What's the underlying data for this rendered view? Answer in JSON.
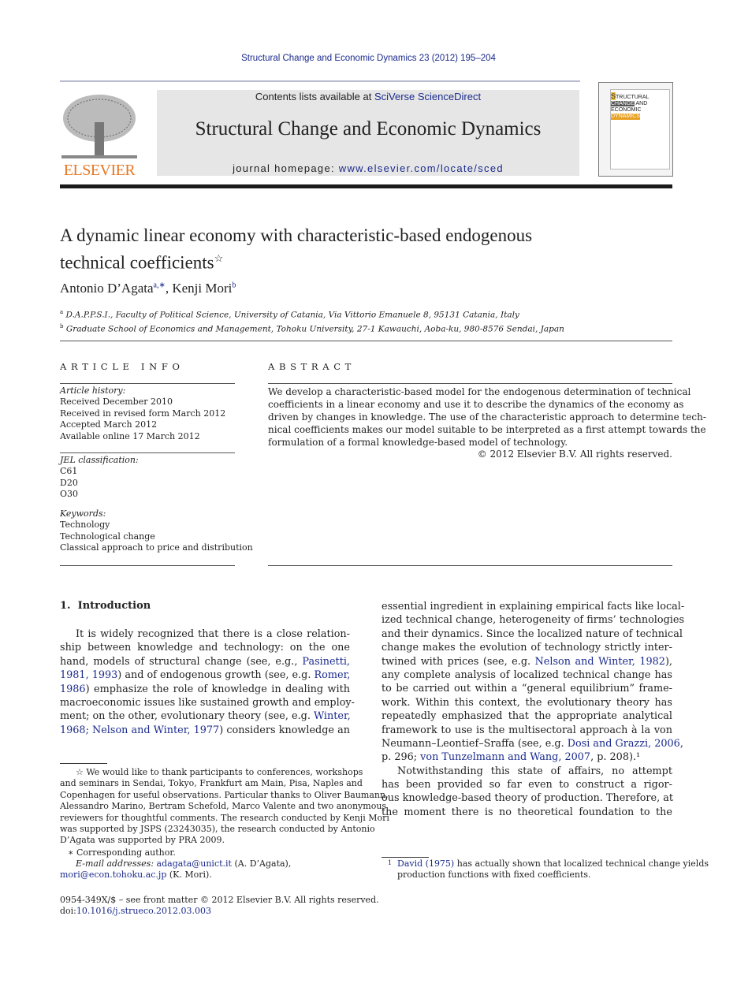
{
  "header": {
    "citation": "Structural Change and Economic Dynamics 23 (2012) 195–204",
    "contents_prefix": "Contents lists available at ",
    "contents_link": "SciVerse ScienceDirect",
    "journal_title": "Structural Change and Economic Dynamics",
    "homepage_prefix": "journal homepage: ",
    "homepage_link": "www.elsevier.com/locate/sced",
    "publisher_logo": "ELSEVIER",
    "cover_text": [
      "S",
      "TRUCTURAL",
      "CHANGE",
      "AND",
      "ECONOMIC",
      "DYNAMICS"
    ]
  },
  "article": {
    "title_line1": "A dynamic linear economy with characteristic-based endogenous",
    "title_line2": "technical coefficients",
    "title_mark": "☆",
    "authors": [
      {
        "name": "Antonio D’Agata",
        "sup": "a,∗"
      },
      {
        "name": "Kenji Mori",
        "sup": "b"
      }
    ],
    "affiliations": [
      {
        "mark": "a",
        "text": "D.A.P.P.S.I., Faculty of Political Science, University of Catania, Via Vittorio Emanuele 8, 95131 Catania, Italy"
      },
      {
        "mark": "b",
        "text": "Graduate School of Economics and Management, Tohoku University, 27-1 Kawauchi, Aoba-ku, 980-8576 Sendai, Japan"
      }
    ]
  },
  "info": {
    "heading": "A R T I C L E   I N F O",
    "history_label": "Article history:",
    "history": [
      "Received December 2010",
      "Received in revised form March 2012",
      "Accepted March 2012",
      "Available online 17 March 2012"
    ],
    "jel_label": "JEL classification:",
    "jel": [
      "C61",
      "D20",
      "O30"
    ],
    "keywords_label": "Keywords:",
    "keywords": [
      "Technology",
      "Technological change",
      "Classical approach to price and distribution"
    ]
  },
  "abstract": {
    "heading": "A B S T R A C T",
    "lines": [
      "We develop a characteristic-based model for the endogenous determination of technical",
      "coefficients in a linear economy and use it to describe the dynamics of the economy as",
      "driven by changes in knowledge. The use of the characteristic approach to determine tech-",
      "nical coefficients makes our model suitable to be interpreted as a first attempt towards the",
      "formulation of a formal knowledge-based model of technology."
    ],
    "copyright": "© 2012 Elsevier B.V. All rights reserved."
  },
  "body": {
    "section_heading": "1.  Introduction",
    "left_lines": [
      "It is widely recognized that there is a close relation-",
      "ship between knowledge and technology: on the one",
      "hand, models of structural change (see, e.g., |Pasinetti,|",
      "|1981, 1993|) and of endogenous growth (see, e.g. |Romer,|",
      "|1986|) emphasize the role of knowledge in dealing with",
      "macroeconomic issues like sustained growth and employ-",
      "ment; on the other, evolutionary theory (see, e.g. |Winter,|",
      "|1968; Nelson and Winter, 1977|) considers knowledge an"
    ],
    "right_lines": [
      "essential ingredient in explaining empirical facts like local-",
      "ized technical change, heterogeneity of firms’ technologies",
      "and their dynamics. Since the localized nature of technical",
      "change makes the evolution of technology strictly inter-",
      "twined with prices (see, e.g. |Nelson and Winter, 1982|),",
      "any complete analysis of localized technical change has",
      "to be carried out within a “general equilibrium” frame-",
      "work. Within this context, the evolutionary theory has",
      "repeatedly emphasized that the appropriate analytical",
      "framework to use is the multisectoral approach à la von",
      "Neumann–Leontief–Sraffa (see, e.g. |Dosi and Grazzi, 2006|,",
      "p. 296; |von Tunzelmann and Wang, 2007|, p. 208).¹",
      "Notwithstanding this state of affairs, no attempt",
      "has been provided so far even to construct a rigor-",
      "ous knowledge-based theory of production. Therefore, at",
      "the moment there is no theoretical foundation to the"
    ]
  },
  "footnotes": {
    "star_lines": [
      "☆  We would like to thank participants to conferences, workshops",
      "and seminars in Sendai, Tokyo, Frankfurt am Main, Pisa, Naples and",
      "Copenhagen for useful observations. Particular thanks to Oliver Baumann,",
      "Alessandro Marino, Bertram Schefold, Marco Valente and two anonymous",
      "reviewers for thoughtful comments. The research conducted by Kenji Mori",
      "was supported by JSPS (23243035), the research conducted by Antonio",
      "D’Agata was supported by PRA 2009."
    ],
    "corresponding": "∗  Corresponding author.",
    "email_label": "E-mail addresses: ",
    "email1": "adagata@unict.it",
    "email1_name": " (A. D’Agata),",
    "email2": "mori@econ.tohoku.ac.jp",
    "email2_name": " (K. Mori).",
    "front_matter": "0954-349X/$ – see front matter © 2012 Elsevier B.V. All rights reserved.",
    "doi_prefix": "doi:",
    "doi": "10.1016/j.strueco.2012.03.003",
    "fn1_mark": "1",
    "fn1_lines": [
      "|David (1975)| has actually shown that localized technical change yields",
      "production functions with fixed coefficients."
    ]
  },
  "colors": {
    "link": "#1a2a8c",
    "elsevier_orange": "#e87722",
    "banner": "#e6e6e6"
  }
}
